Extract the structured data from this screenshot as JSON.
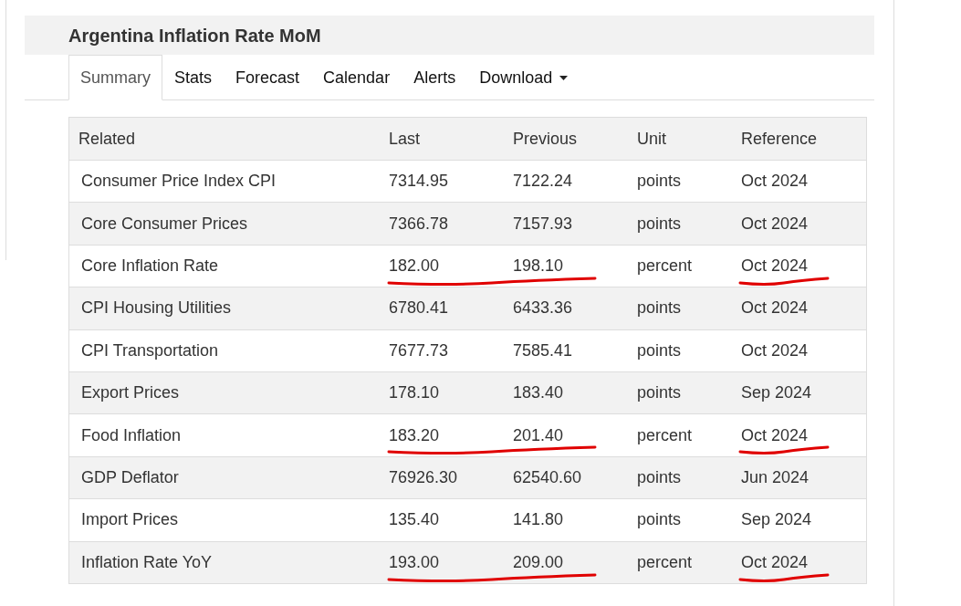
{
  "title": "Argentina Inflation Rate MoM",
  "tabs": [
    {
      "label": "Summary",
      "selected": true,
      "dropdown": false
    },
    {
      "label": "Stats",
      "selected": false,
      "dropdown": false
    },
    {
      "label": "Forecast",
      "selected": false,
      "dropdown": false
    },
    {
      "label": "Calendar",
      "selected": false,
      "dropdown": false
    },
    {
      "label": "Alerts",
      "selected": false,
      "dropdown": false
    },
    {
      "label": "Download",
      "selected": false,
      "dropdown": true
    }
  ],
  "table": {
    "columns": [
      "Related",
      "Last",
      "Previous",
      "Unit",
      "Reference"
    ],
    "rows": [
      {
        "cells": [
          "Consumer Price Index CPI",
          "7314.95",
          "7122.24",
          "points",
          "Oct 2024"
        ],
        "marked": false
      },
      {
        "cells": [
          "Core Consumer Prices",
          "7366.78",
          "7157.93",
          "points",
          "Oct 2024"
        ],
        "marked": false
      },
      {
        "cells": [
          "Core Inflation Rate",
          "182.00",
          "198.10",
          "percent",
          "Oct 2024"
        ],
        "marked": true
      },
      {
        "cells": [
          "CPI Housing Utilities",
          "6780.41",
          "6433.36",
          "points",
          "Oct 2024"
        ],
        "marked": false
      },
      {
        "cells": [
          "CPI Transportation",
          "7677.73",
          "7585.41",
          "points",
          "Oct 2024"
        ],
        "marked": false
      },
      {
        "cells": [
          "Export Prices",
          "178.10",
          "183.40",
          "points",
          "Sep 2024"
        ],
        "marked": false
      },
      {
        "cells": [
          "Food Inflation",
          "183.20",
          "201.40",
          "percent",
          "Oct 2024"
        ],
        "marked": true
      },
      {
        "cells": [
          "GDP Deflator",
          "76926.30",
          "62540.60",
          "points",
          "Jun 2024"
        ],
        "marked": false
      },
      {
        "cells": [
          "Import Prices",
          "135.40",
          "141.80",
          "points",
          "Sep 2024"
        ],
        "marked": false
      },
      {
        "cells": [
          "Inflation Rate YoY",
          "193.00",
          "209.00",
          "percent",
          "Oct 2024"
        ],
        "marked": true
      }
    ]
  }
}
